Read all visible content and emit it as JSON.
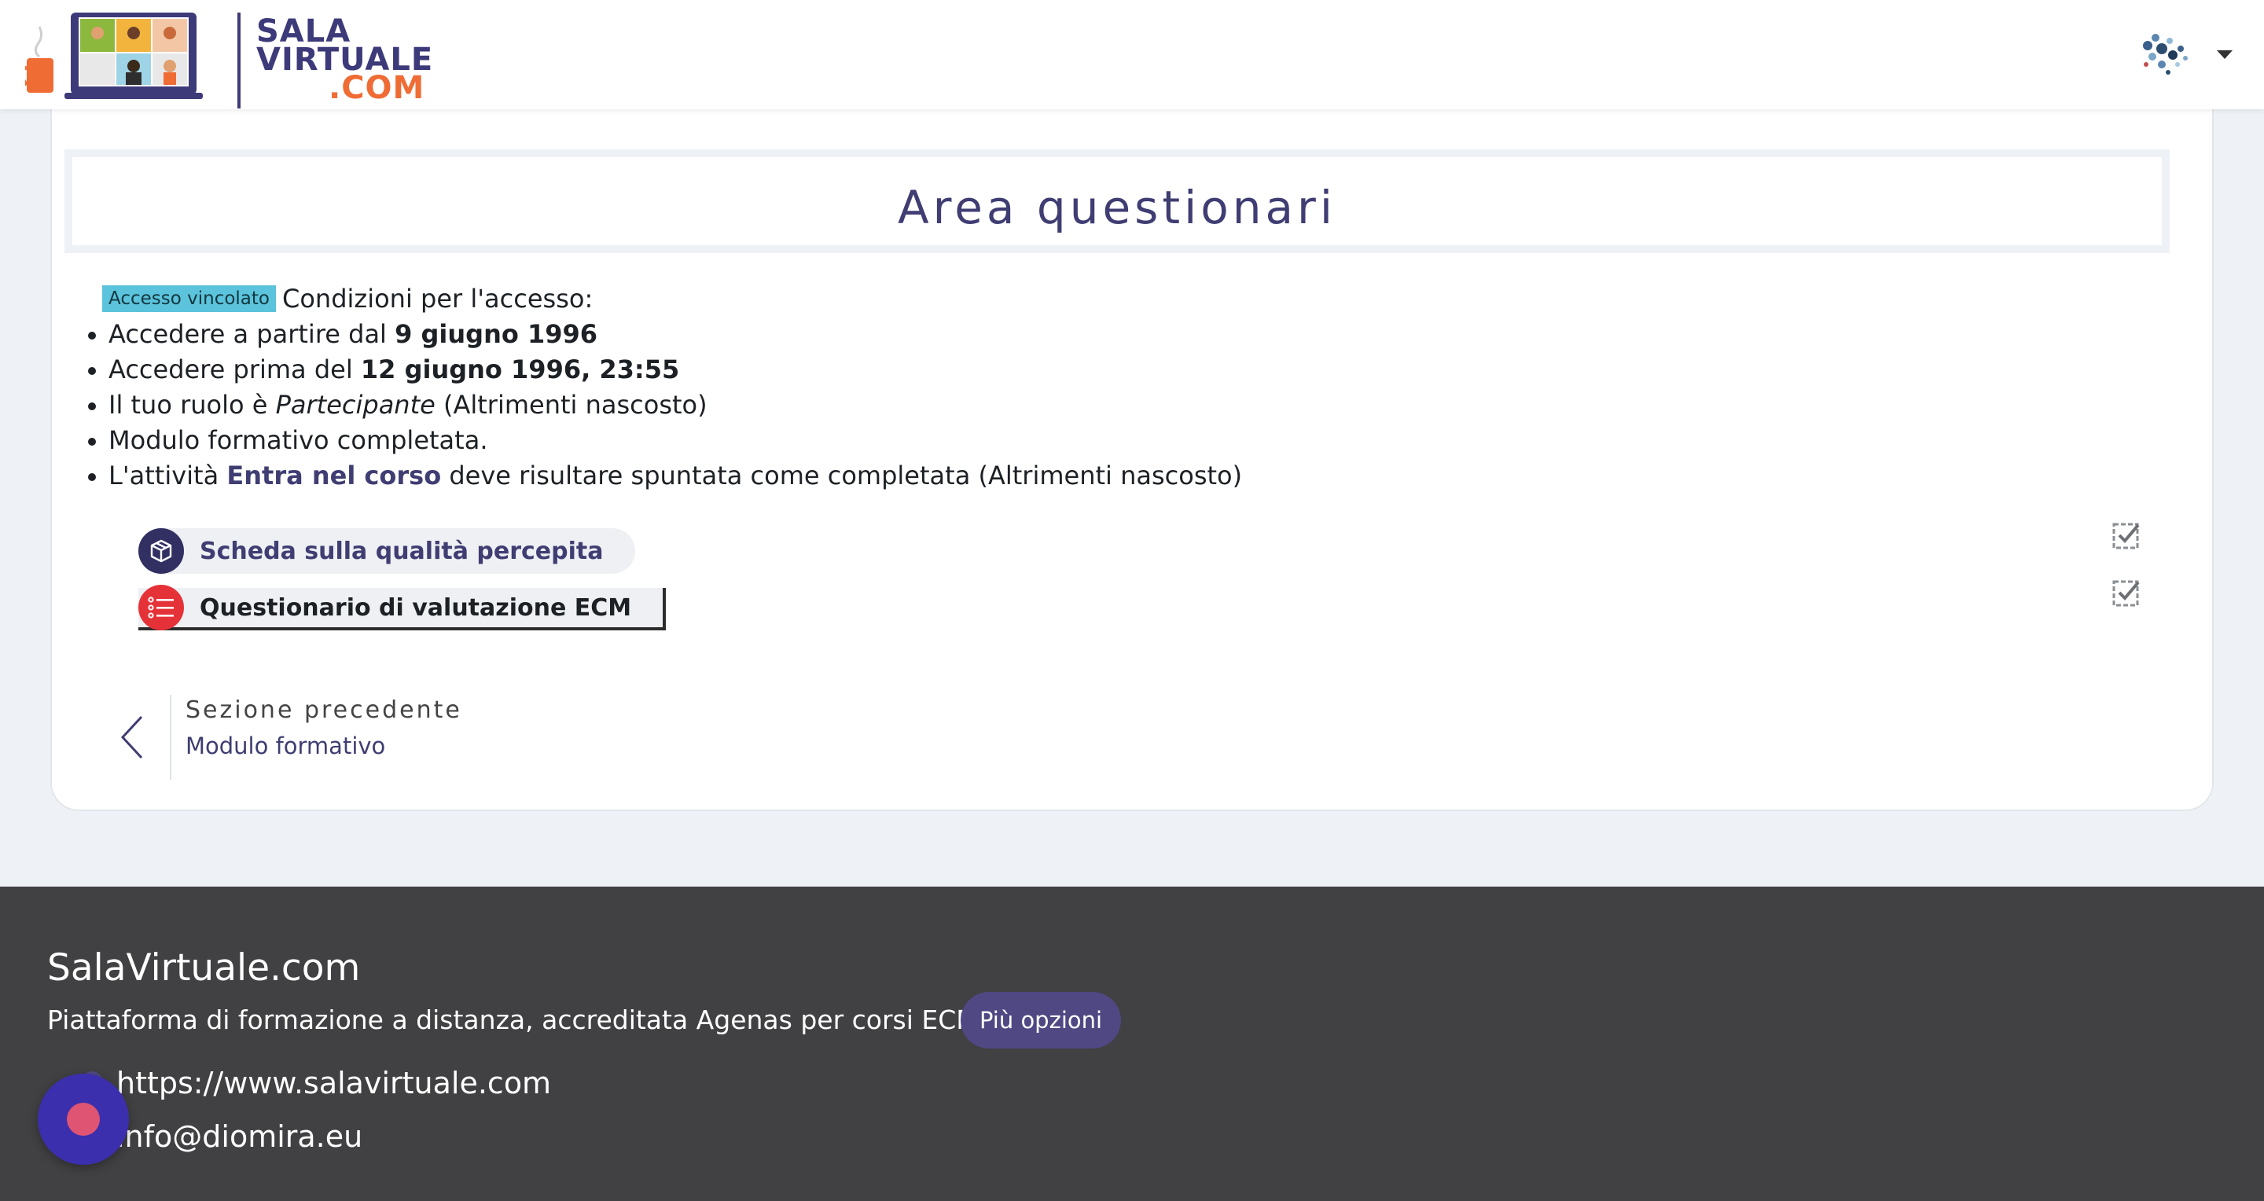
{
  "header": {
    "logo": {
      "line1": "SALA",
      "line2": "VIRTUALE",
      "line3": ".COM"
    }
  },
  "section": {
    "title": "Area questionari",
    "restriction_badge": "Accesso vincolato",
    "restriction_intro": "Condizioni per l'accesso:",
    "conditions": [
      {
        "prefix": "Accedere a partire dal ",
        "bold": "9 giugno 1996",
        "suffix": ""
      },
      {
        "prefix": "Accedere prima del ",
        "bold": "12 giugno 1996, 23:55",
        "suffix": ""
      },
      {
        "prefix": "Il tuo ruolo è ",
        "italic": "Partecipante",
        "suffix": " (Altrimenti nascosto)"
      },
      {
        "prefix": "Modulo formativo completata.",
        "bold": "",
        "suffix": ""
      },
      {
        "prefix": "L'attività ",
        "bold": "Entra nel corso",
        "suffix": " deve risultare spuntata come completata (Altrimenti nascosto)"
      }
    ],
    "activities": [
      {
        "label": "Scheda sulla qualità percepita",
        "icon": "feedback-box-icon",
        "completion_icon": "checkbox-checked-icon"
      },
      {
        "label": "Questionario di valutazione ECM",
        "icon": "quiz-list-icon",
        "completion_icon": "checkbox-checked-icon"
      }
    ],
    "previous": {
      "label": "Sezione precedente",
      "link": "Modulo formativo"
    }
  },
  "footer": {
    "title": "SalaVirtuale.com",
    "tagline": "Piattaforma di formazione a distanza, accreditata Agenas per corsi ECM",
    "more_button": "Più opzioni",
    "url": "https://www.salavirtuale.com",
    "email": "info@diomira.eu"
  },
  "colors": {
    "brand_primary": "#3f3d72",
    "brand_orange": "#ef6c35",
    "badge_info": "#5bc3dc",
    "footer_bg": "#414042",
    "page_bg": "#eef2f7",
    "quiz_red": "#e53238"
  }
}
